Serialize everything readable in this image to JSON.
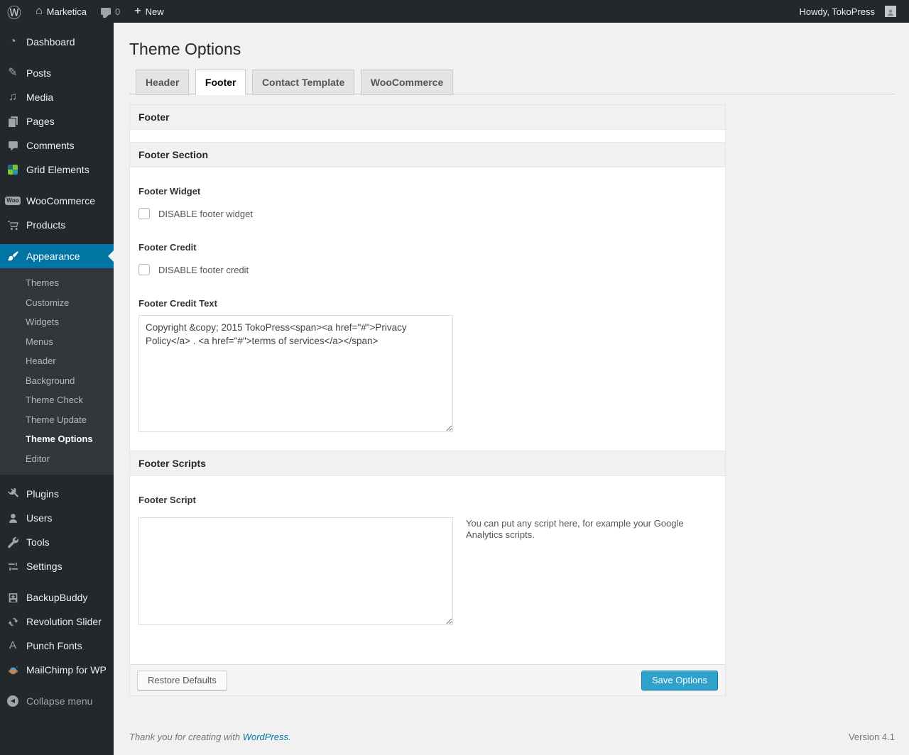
{
  "admin_bar": {
    "site_name": "Marketica",
    "comment_count": "0",
    "new_label": "New",
    "howdy": "Howdy, TokoPress"
  },
  "icons": {
    "wordpress": "Ⓦ",
    "home": "⌂",
    "plus": "+",
    "dashboard": "◔",
    "media": "♫",
    "posts": "✎",
    "woo_badge": "Woo",
    "punch_fonts": "A",
    "collapse_arrow": "◀"
  },
  "sidebar": {
    "items": {
      "dashboard": "Dashboard",
      "posts": "Posts",
      "media": "Media",
      "pages": "Pages",
      "comments": "Comments",
      "grid_elements": "Grid Elements",
      "woocommerce": "WooCommerce",
      "products": "Products",
      "appearance": "Appearance",
      "plugins": "Plugins",
      "users": "Users",
      "tools": "Tools",
      "settings": "Settings",
      "backupbuddy": "BackupBuddy",
      "revolution_slider": "Revolution Slider",
      "punch_fonts": "Punch Fonts",
      "mailchimp": "MailChimp for WP",
      "collapse": "Collapse menu"
    },
    "appearance_submenu": [
      "Themes",
      "Customize",
      "Widgets",
      "Menus",
      "Header",
      "Background",
      "Theme Check",
      "Theme Update",
      "Theme Options",
      "Editor"
    ],
    "active_item": "Appearance",
    "active_submenu": "Theme Options"
  },
  "page": {
    "title": "Theme Options",
    "tabs": [
      "Header",
      "Footer",
      "Contact Template",
      "WooCommerce"
    ],
    "active_tab": "Footer"
  },
  "panel": {
    "heading": "Footer",
    "section1": {
      "heading": "Footer Section",
      "footer_widget_label": "Footer Widget",
      "footer_widget_checkbox": "DISABLE footer widget",
      "footer_widget_checked": false,
      "footer_credit_label": "Footer Credit",
      "footer_credit_checkbox": "DISABLE footer credit",
      "footer_credit_checked": false,
      "footer_credit_text_label": "Footer Credit Text",
      "footer_credit_text_value": "Copyright &copy; 2015 TokoPress<span><a href=\"#\">Privacy Policy</a> . <a href=\"#\">terms of services</a></span>"
    },
    "section2": {
      "heading": "Footer Scripts",
      "footer_script_label": "Footer Script",
      "footer_script_value": "",
      "description": "You can put any script here, for example your Google Analytics scripts."
    },
    "buttons": {
      "restore": "Restore Defaults",
      "save": "Save Options"
    }
  },
  "footer": {
    "thanks_prefix": "Thank you for creating with ",
    "wordpress_link": "WordPress",
    "thanks_suffix": ".",
    "version": "Version 4.1"
  },
  "colors": {
    "accent": "#0074a2",
    "primary_button": "#2ea2cc",
    "menu_bg": "#23282d",
    "submenu_bg": "#32373c",
    "content_bg": "#f1f1f1"
  }
}
